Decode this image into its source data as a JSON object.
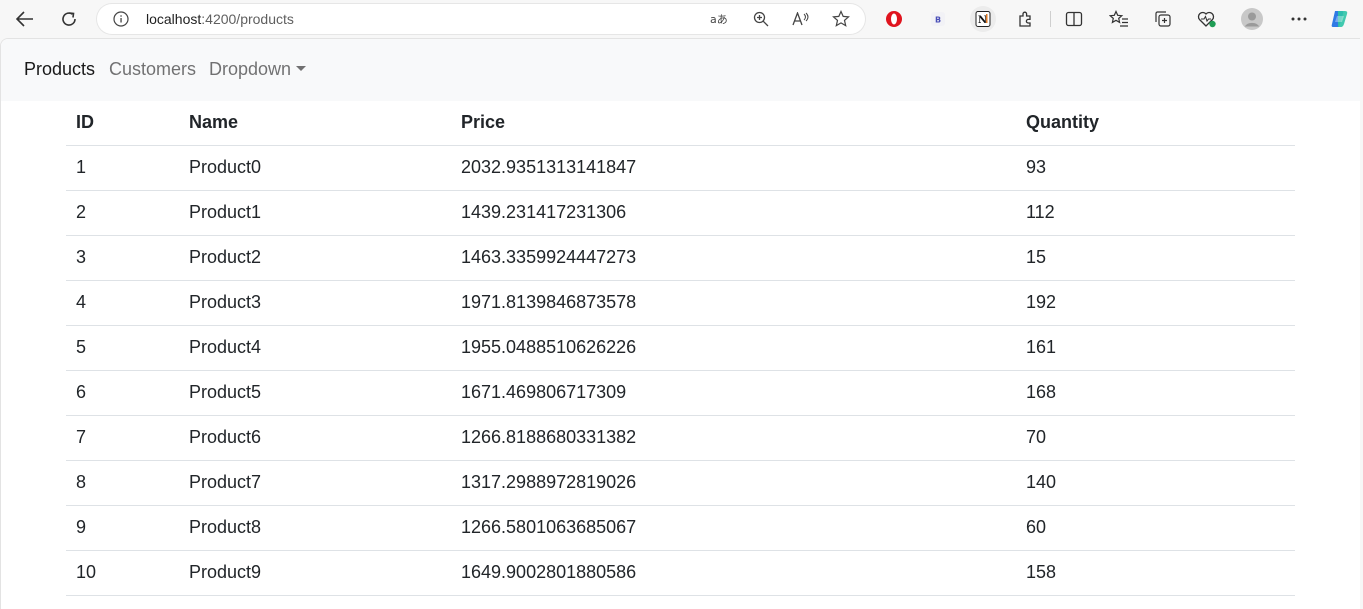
{
  "browser": {
    "url_host": "localhost",
    "url_rest": ":4200/products",
    "icons": {
      "back": "back-arrow-icon",
      "refresh": "refresh-icon",
      "info": "info-icon",
      "translate": "translate-icon",
      "zoom": "zoom-icon",
      "read_aloud": "read-aloud-icon",
      "favorite": "star-icon",
      "extensions": [
        "opera-extension-icon",
        "bing-extension-icon",
        "notion-extension-icon",
        "puzzle-extensions-icon"
      ],
      "toolbar": [
        "split-screen-icon",
        "favorites-icon",
        "collections-icon",
        "browser-essentials-icon",
        "profile-avatar-icon",
        "more-menu-icon",
        "copilot-icon"
      ]
    },
    "ext_labels": {
      "bing": "B",
      "notion": "N"
    }
  },
  "navbar": {
    "items": [
      {
        "label": "Products",
        "active": true
      },
      {
        "label": "Customers",
        "active": false
      },
      {
        "label": "Dropdown",
        "active": false,
        "has_caret": true
      }
    ]
  },
  "table": {
    "headers": [
      "ID",
      "Name",
      "Price",
      "Quantity"
    ],
    "rows": [
      [
        "1",
        "Product0",
        "2032.9351313141847",
        "93"
      ],
      [
        "2",
        "Product1",
        "1439.231417231306",
        "112"
      ],
      [
        "3",
        "Product2",
        "1463.3359924447273",
        "15"
      ],
      [
        "4",
        "Product3",
        "1971.8139846873578",
        "192"
      ],
      [
        "5",
        "Product4",
        "1955.0488510626226",
        "161"
      ],
      [
        "6",
        "Product5",
        "1671.469806717309",
        "168"
      ],
      [
        "7",
        "Product6",
        "1266.8188680331382",
        "70"
      ],
      [
        "8",
        "Product7",
        "1317.2988972819026",
        "140"
      ],
      [
        "9",
        "Product8",
        "1266.5801063685067",
        "60"
      ],
      [
        "10",
        "Product9",
        "1649.9002801880586",
        "158"
      ]
    ]
  },
  "colors": {
    "navbar_bg": "#f8f9fa",
    "table_border": "#dee2e6",
    "text": "#212529",
    "opera_red": "#e0141e",
    "copilot_blue": "#2f7ae5"
  }
}
